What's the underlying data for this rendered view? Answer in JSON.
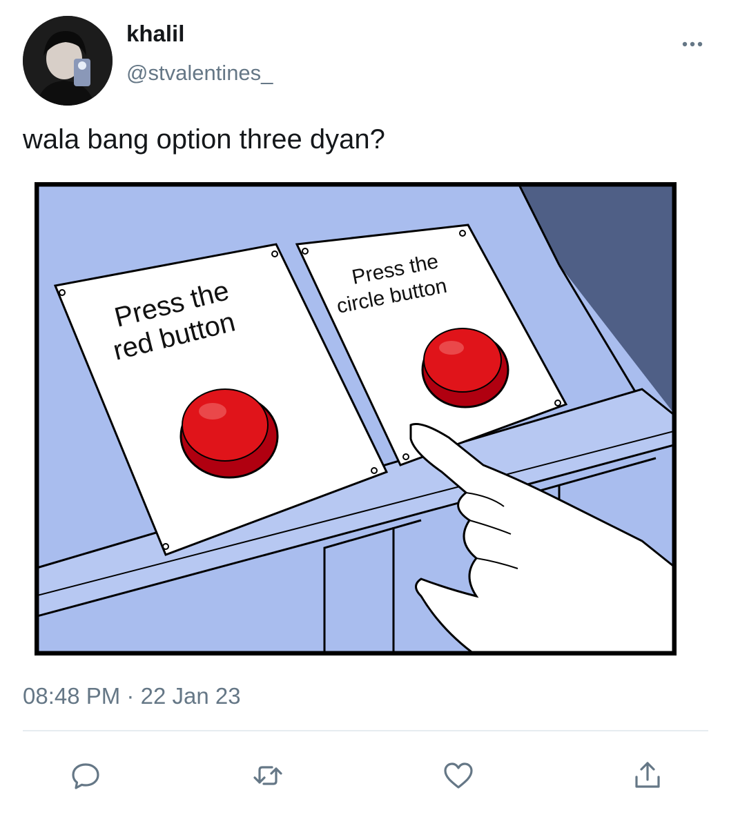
{
  "tweet": {
    "display_name": "khalil",
    "handle": "@stvalentines_",
    "text": "wala bang option three dyan?",
    "time": "08:48 PM",
    "separator": "·",
    "date": "22 Jan 23"
  },
  "media": {
    "sign_left": {
      "line1": "Press the",
      "line2": "red button"
    },
    "sign_right": {
      "line1": "Press the",
      "line2": "circle button"
    }
  },
  "icons": {
    "more": "more-horizontal-icon",
    "reply": "reply-icon",
    "retweet": "retweet-icon",
    "like": "heart-icon",
    "share": "share-icon"
  },
  "colors": {
    "primary_text": "#14171a",
    "secondary_text": "#657786",
    "divider": "#e6ecf0",
    "button_red": "#e0141a",
    "panel_blue": "#aabdf0"
  }
}
